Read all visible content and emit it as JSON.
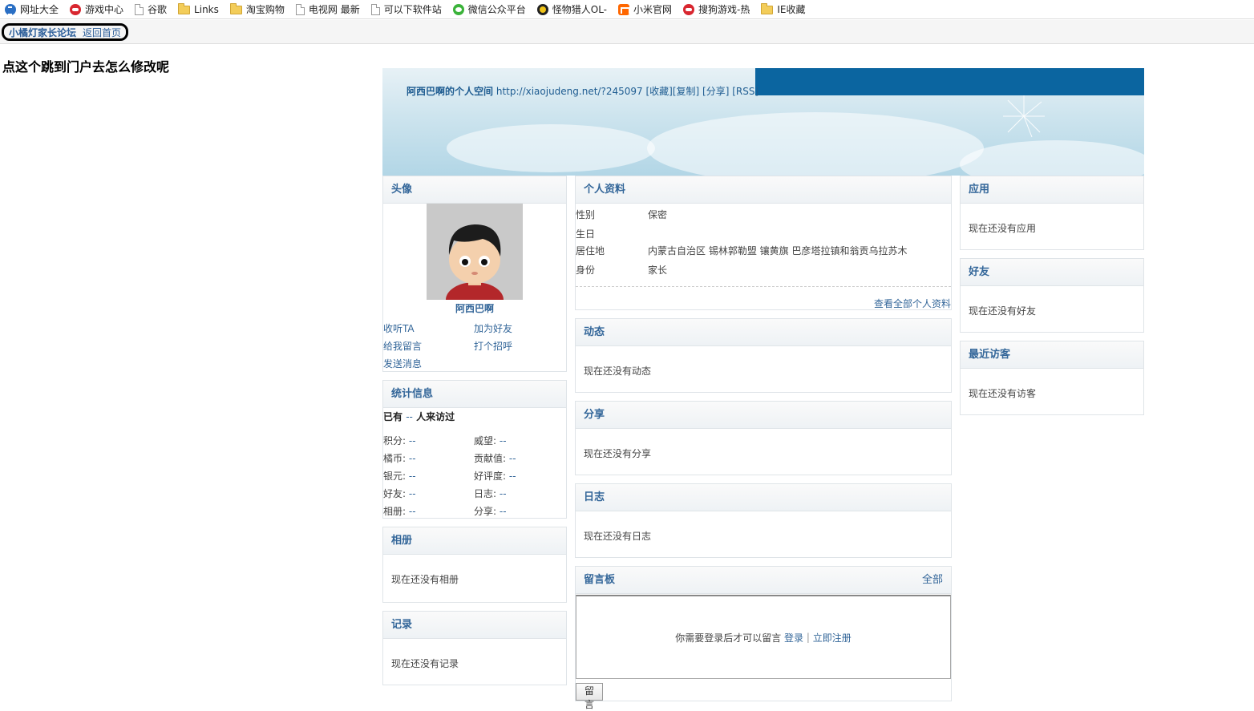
{
  "bookmarks": [
    {
      "label": "网址大全",
      "icon": "sogou-icon"
    },
    {
      "label": "游戏中心",
      "icon": "sogou-game-icon"
    },
    {
      "label": "谷歌",
      "icon": "page-icon"
    },
    {
      "label": "Links",
      "icon": "folder-icon"
    },
    {
      "label": "淘宝购物",
      "icon": "folder-icon"
    },
    {
      "label": "电视网 最新",
      "icon": "page-icon"
    },
    {
      "label": "可以下软件站",
      "icon": "page-icon"
    },
    {
      "label": "微信公众平台",
      "icon": "wechat-icon"
    },
    {
      "label": "怪物猎人OL-",
      "icon": "monster-icon"
    },
    {
      "label": "小米官网",
      "icon": "mi-icon"
    },
    {
      "label": "搜狗游戏-热",
      "icon": "sogou-game-icon"
    },
    {
      "label": "IE收藏",
      "icon": "folder-icon"
    }
  ],
  "nav": {
    "forum": "小橘灯家长论坛",
    "home": "返回首页"
  },
  "annotation": "点这个跳到门户去怎么修改呢",
  "banner": {
    "space_name": "阿西巴啊的个人空间",
    "url": "http://xiaojudeng.net/?245097",
    "actions": [
      "[收藏]",
      "[复制]",
      "[分享]",
      "[RSS]"
    ]
  },
  "avatar": {
    "title": "头像",
    "username": "阿西巴啊",
    "links": [
      "收听TA",
      "加为好友",
      "给我留言",
      "打个招呼",
      "发送消息"
    ]
  },
  "stats": {
    "title": "统计信息",
    "visits_prefix": "已有",
    "visits_value": "--",
    "visits_suffix": "人来访过",
    "items": [
      {
        "label": "积分:",
        "value": "--"
      },
      {
        "label": "威望:",
        "value": "--"
      },
      {
        "label": "橘币:",
        "value": "--"
      },
      {
        "label": "贡献值:",
        "value": "--"
      },
      {
        "label": "银元:",
        "value": "--"
      },
      {
        "label": "好评度:",
        "value": "--"
      },
      {
        "label": "好友:",
        "value": "--"
      },
      {
        "label": "日志:",
        "value": "--"
      },
      {
        "label": "相册:",
        "value": "--"
      },
      {
        "label": "分享:",
        "value": "--"
      }
    ]
  },
  "album": {
    "title": "相册",
    "empty": "现在还没有相册"
  },
  "records": {
    "title": "记录",
    "empty": "现在还没有记录"
  },
  "profile": {
    "title": "个人资料",
    "rows": [
      {
        "label": "性别",
        "value": "保密"
      },
      {
        "label": "生日",
        "value": ""
      },
      {
        "label": "居住地",
        "value": "内蒙古自治区 锡林郭勒盟 镶黄旗 巴彦塔拉镇和翁贡乌拉苏木"
      },
      {
        "label": "身份",
        "value": "家长"
      }
    ],
    "more": "查看全部个人资料"
  },
  "feed": {
    "title": "动态",
    "empty": "现在还没有动态"
  },
  "share": {
    "title": "分享",
    "empty": "现在还没有分享"
  },
  "blog": {
    "title": "日志",
    "empty": "现在还没有日志"
  },
  "guestbook": {
    "title": "留言板",
    "all": "全部",
    "prompt": "你需要登录后才可以留言",
    "login": "登录",
    "sep": "|",
    "register": "立即注册",
    "button": "留言"
  },
  "apps": {
    "title": "应用",
    "empty": "现在还没有应用"
  },
  "friends": {
    "title": "好友",
    "empty": "现在还没有好友"
  },
  "visitors": {
    "title": "最近访客",
    "empty": "现在还没有访客"
  }
}
